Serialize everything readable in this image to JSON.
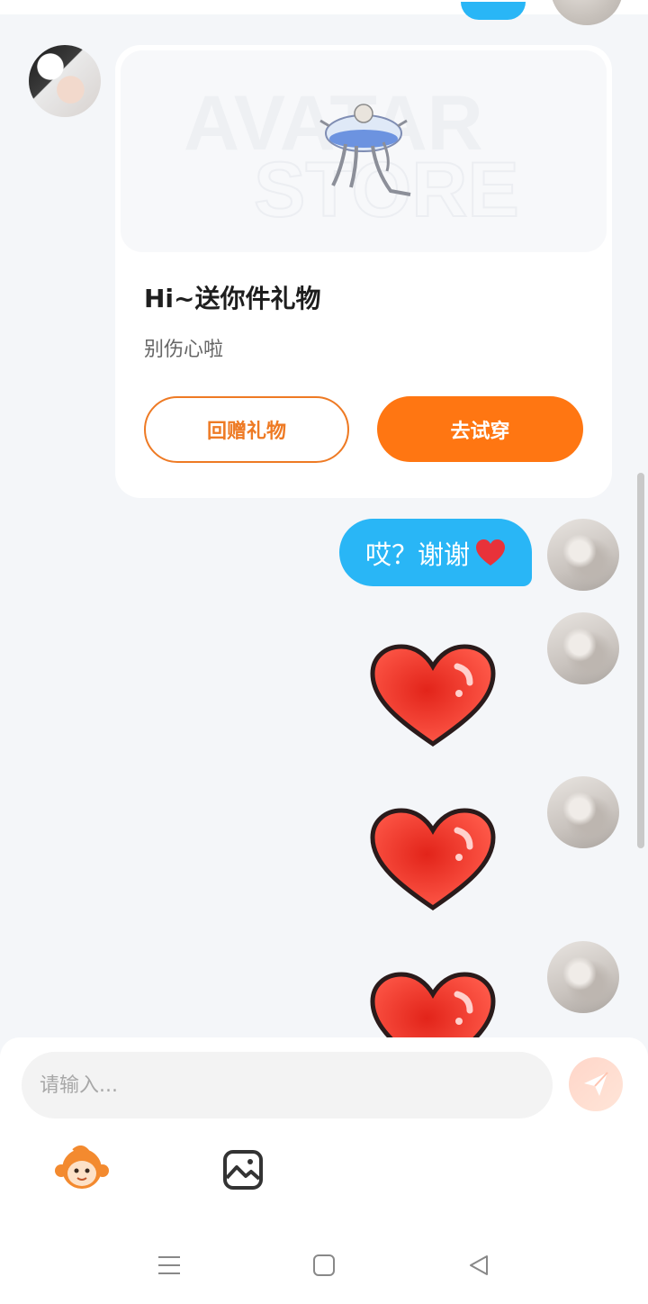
{
  "gift_card": {
    "image_text_line1": "AVATAR",
    "image_text_line2": "STORE",
    "title": "Hi~送你件礼物",
    "subtitle": "别伤心啦",
    "return_gift_button": "回赠礼物",
    "try_on_button": "去试穿"
  },
  "messages": {
    "outgoing_text": "哎？谢谢",
    "outgoing_emoji": "heart-icon",
    "sticker": "red-heart-sticker"
  },
  "input": {
    "placeholder": "请输入..."
  },
  "toolbar": {
    "emoji_icon": "monkey-emoji-icon",
    "image_icon": "image-icon",
    "send_icon": "send-icon"
  },
  "nav": {
    "menu_icon": "menu-icon",
    "home_icon": "home-icon",
    "back_icon": "back-icon"
  },
  "colors": {
    "accent_orange": "#ff7612",
    "bubble_blue": "#29b6f6",
    "background": "#f4f6f9"
  }
}
